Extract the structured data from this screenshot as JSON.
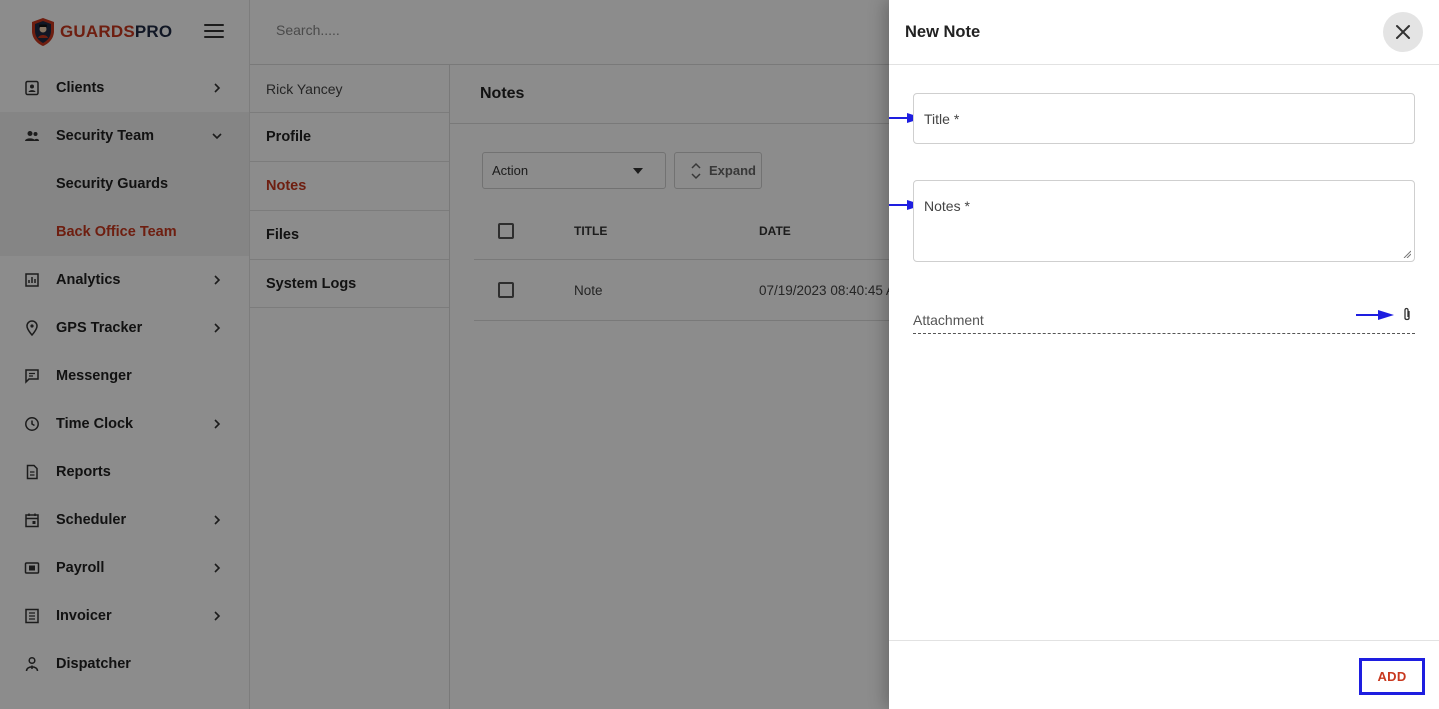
{
  "brand": {
    "part1": "GUARDS",
    "part2": "PRO"
  },
  "search": {
    "placeholder": "Search....."
  },
  "sidebar": {
    "items": [
      {
        "label": "Clients",
        "icon": "contact-card-icon",
        "has_chevron": true
      },
      {
        "label": "Security Team",
        "icon": "people-icon",
        "expanded": true,
        "children": [
          {
            "label": "Security Guards",
            "active": false
          },
          {
            "label": "Back Office Team",
            "active": true
          }
        ]
      },
      {
        "label": "Analytics",
        "icon": "bar-chart-icon",
        "has_chevron": true
      },
      {
        "label": "GPS Tracker",
        "icon": "location-pin-icon",
        "has_chevron": true
      },
      {
        "label": "Messenger",
        "icon": "chat-icon",
        "has_chevron": false
      },
      {
        "label": "Time Clock",
        "icon": "clock-icon",
        "has_chevron": true
      },
      {
        "label": "Reports",
        "icon": "document-icon",
        "has_chevron": false
      },
      {
        "label": "Scheduler",
        "icon": "calendar-icon",
        "has_chevron": true
      },
      {
        "label": "Payroll",
        "icon": "money-icon",
        "has_chevron": true
      },
      {
        "label": "Invoicer",
        "icon": "list-icon",
        "has_chevron": true
      },
      {
        "label": "Dispatcher",
        "icon": "dispatcher-icon",
        "has_chevron": false
      }
    ]
  },
  "submenu": {
    "person": "Rick Yancey",
    "items": [
      {
        "label": "Profile",
        "active": false
      },
      {
        "label": "Notes",
        "active": true
      },
      {
        "label": "Files",
        "active": false
      },
      {
        "label": "System Logs",
        "active": false
      }
    ]
  },
  "main": {
    "title": "Notes",
    "action_label": "Action",
    "expand_label": "Expand",
    "columns": {
      "title": "TITLE",
      "date": "DATE"
    },
    "rows": [
      {
        "title": "Note",
        "date": "07/19/2023 08:40:45 A"
      }
    ]
  },
  "drawer": {
    "title": "New Note",
    "title_field_label": "Title *",
    "notes_field_label": "Notes *",
    "attachment_label": "Attachment",
    "add_label": "ADD",
    "annotation_color": "#1e1ee0"
  },
  "colors": {
    "accent": "#c8381e",
    "brand_dark": "#1f2a44"
  }
}
